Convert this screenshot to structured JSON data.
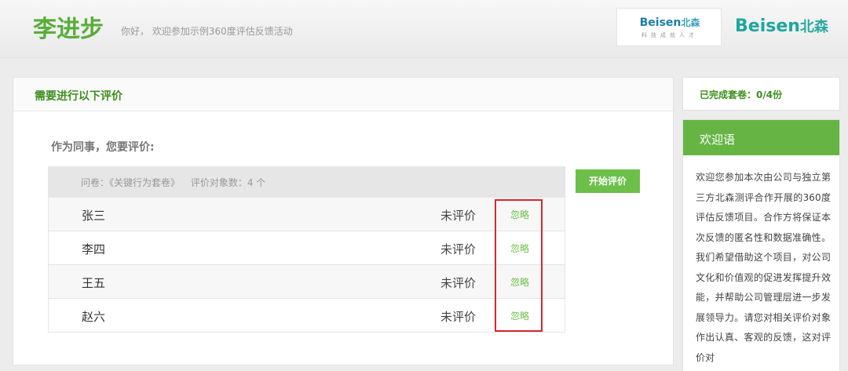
{
  "header": {
    "user_name": "李进步",
    "greeting": "你好， 欢迎参加示例360度评估反馈活动",
    "logo_small_en": "Beisen",
    "logo_small_cn": "北森",
    "logo_small_tagline": "科技成就人才",
    "logo_big_en": "Beisen",
    "logo_big_cn": "北森",
    "brand_color": "#1fa6a0"
  },
  "main": {
    "panel_title": "需要进行以下评价",
    "role_label": "作为同事，您要评价:",
    "survey": {
      "label": "问卷：《关键行为套卷》",
      "count_label": "评价对象数：4 个"
    },
    "start_button": "开始评价",
    "rows": [
      {
        "name": "张三",
        "status": "未评价",
        "ignore": "忽略"
      },
      {
        "name": "李四",
        "status": "未评价",
        "ignore": "忽略"
      },
      {
        "name": "王五",
        "status": "未评价",
        "ignore": "忽略"
      },
      {
        "name": "赵六",
        "status": "未评价",
        "ignore": "忽略"
      }
    ],
    "accent_color": "#6cc04a",
    "highlight_color": "#d9262c"
  },
  "sidebar": {
    "progress": "已完成套卷：0/4份",
    "welcome_title": "欢迎语",
    "welcome_text": "欢迎您参加本次由公司与独立第三方北森测评合作开展的360度评估反馈项目。合作方将保证本次反馈的匿名性和数据准确性。我们希望借助这个项目，对公司文化和价值观的促进发挥提升效能，并帮助公司管理层进一步发展领导力。请您对相关评价对象作出认真、客观的反馈，这对评价对"
  }
}
